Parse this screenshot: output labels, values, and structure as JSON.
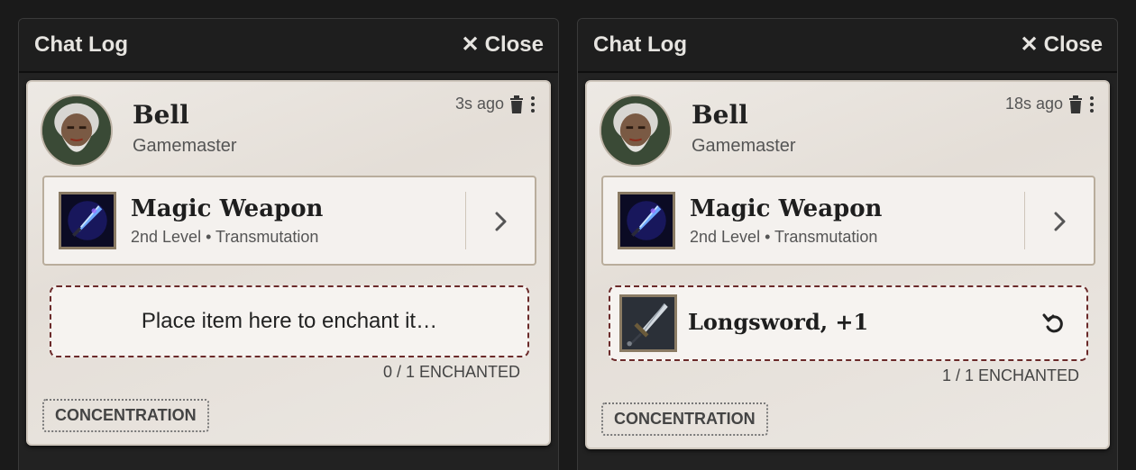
{
  "panels": [
    {
      "title": "Chat Log",
      "close_label": "Close",
      "message": {
        "speaker": "Bell",
        "role": "Gamemaster",
        "timestamp": "3s ago",
        "spell": {
          "name": "Magic Weapon",
          "subtitle": "2nd Level • Transmutation"
        },
        "drop_placeholder": "Place item here to enchant it…",
        "enchant_count": "0 / 1 ENCHANTED",
        "badge": "CONCENTRATION"
      }
    },
    {
      "title": "Chat Log",
      "close_label": "Close",
      "message": {
        "speaker": "Bell",
        "role": "Gamemaster",
        "timestamp": "18s ago",
        "spell": {
          "name": "Magic Weapon",
          "subtitle": "2nd Level • Transmutation"
        },
        "enchanted_item": "Longsword, +1",
        "enchant_count": "1 / 1 ENCHANTED",
        "badge": "CONCENTRATION"
      }
    }
  ],
  "colors": {
    "panel_bg": "#222222",
    "card_bg": "#ebe7e2",
    "dashed_border": "#6b2a2a",
    "header_text": "#e6e4e0"
  },
  "icons": {
    "close": "close-icon",
    "delete": "trash-icon",
    "more": "kebab-menu-icon",
    "expand": "chevron-right-icon",
    "undo": "undo-icon"
  }
}
